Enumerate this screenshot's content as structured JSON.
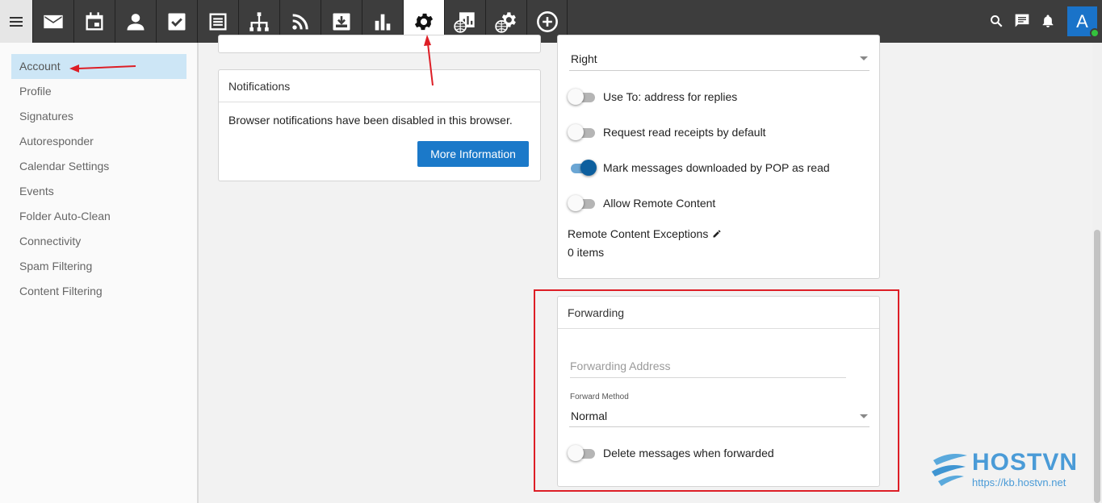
{
  "topbar": {
    "menu_icon": "hamburger-menu-icon",
    "nav_icons": [
      "mail-icon",
      "calendar-icon",
      "contacts-icon",
      "tasks-icon",
      "notes-icon",
      "sitemap-icon",
      "rss-icon",
      "download-box-icon",
      "bar-chart-icon",
      "settings-gear-icon",
      "domain-report-icon",
      "domain-settings-icon",
      "add-circle-icon"
    ],
    "active_icon": "settings-gear-icon",
    "right_icons": [
      "search-icon",
      "chat-icon",
      "bell-icon"
    ],
    "avatar_letter": "A",
    "status": "online"
  },
  "sidebar": {
    "items": [
      {
        "label": "Account",
        "active": true
      },
      {
        "label": "Profile"
      },
      {
        "label": "Signatures"
      },
      {
        "label": "Autoresponder"
      },
      {
        "label": "Calendar Settings"
      },
      {
        "label": "Events"
      },
      {
        "label": "Folder Auto-Clean"
      },
      {
        "label": "Connectivity"
      },
      {
        "label": "Spam Filtering"
      },
      {
        "label": "Content Filtering"
      }
    ]
  },
  "notifications": {
    "title": "Notifications",
    "message": "Browser notifications have been disabled in this browser.",
    "button": "More Information"
  },
  "preferences": {
    "select_value": "Right",
    "toggles": [
      {
        "label": "Use To: address for replies",
        "on": false
      },
      {
        "label": "Request read receipts by default",
        "on": false
      },
      {
        "label": "Mark messages downloaded by POP as read",
        "on": true
      },
      {
        "label": "Allow Remote Content",
        "on": false
      }
    ],
    "exceptions_label": "Remote Content Exceptions",
    "exceptions_count": "0 items"
  },
  "forwarding": {
    "title": "Forwarding",
    "address_placeholder": "Forwarding Address",
    "method_label": "Forward Method",
    "method_value": "Normal",
    "delete_label": "Delete messages when forwarded",
    "delete_on": false
  },
  "watermark": {
    "brand": "HOSTVN",
    "url": "https://kb.hostvn.net"
  },
  "colors": {
    "accent": "#1b79c9",
    "highlight": "#dd1e26",
    "topbar": "#3d3d3d"
  }
}
